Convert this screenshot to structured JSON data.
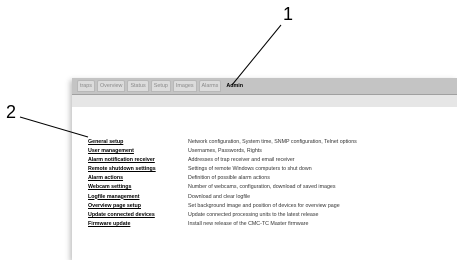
{
  "tabs": [
    {
      "label": "traps",
      "active": false
    },
    {
      "label": "Overview",
      "active": false
    },
    {
      "label": "Status",
      "active": false
    },
    {
      "label": "Setup",
      "active": false
    },
    {
      "label": "Images",
      "active": false
    },
    {
      "label": "Alarms",
      "active": false
    },
    {
      "label": "Admin",
      "active": true
    }
  ],
  "menu": [
    {
      "label": "General setup",
      "description": "Network configuration, System time, SNMP configuration, Telnet options"
    },
    {
      "label": "User management",
      "description": "Usernames, Passwords, Rights"
    },
    {
      "label": "Alarm notification receiver",
      "description": "Addresses of trap receiver and email receiver"
    },
    {
      "label": "Remote shutdown settings",
      "description": "Settings of remote Windows computers to shut down"
    },
    {
      "label": "Alarm actions",
      "description": "Definition of possible alarm actions"
    },
    {
      "label": "Webcam settings",
      "description": "Number of webcams, configuration, download of saved images"
    },
    {
      "label": "Logfile management",
      "description": "Download and clear logfile"
    },
    {
      "label": "Overview page setup",
      "description": "Set background image and position of devices for overview page"
    },
    {
      "label": "Update connected devices",
      "description": "Update connected processing units to the latest release"
    },
    {
      "label": "Firmware update",
      "description": "Install new release of the CMC-TC Master firmware"
    }
  ],
  "callouts": {
    "one": "1",
    "two": "2"
  }
}
